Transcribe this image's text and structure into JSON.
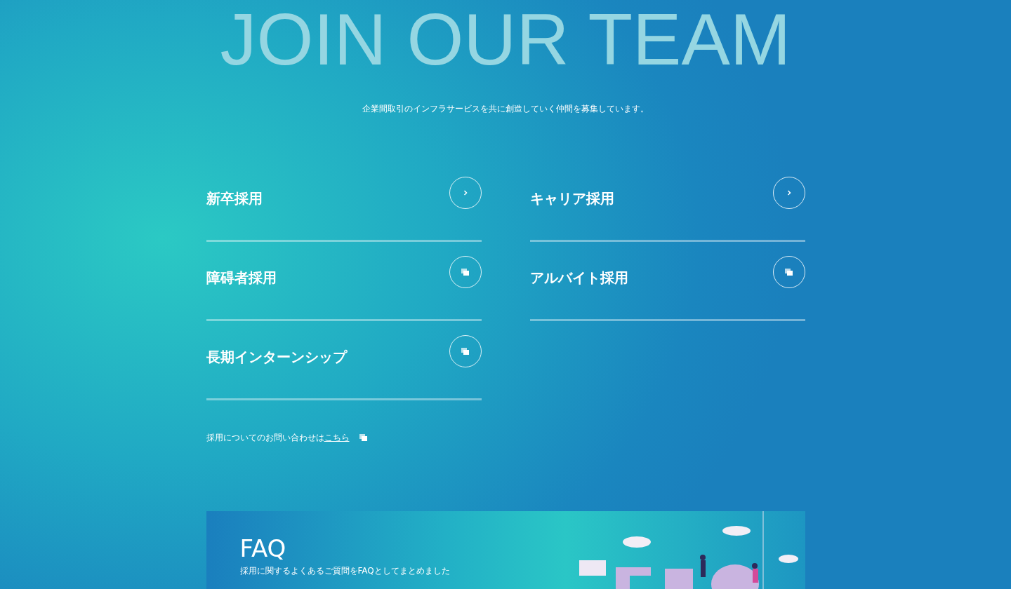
{
  "hero": {
    "title": "JOIN OUR TEAM",
    "lead": "企業間取引のインフラサービスを共に創造していく仲間を募集しています。"
  },
  "positions": [
    {
      "label": "新卒採用",
      "kind": "internal"
    },
    {
      "label": "キャリア採用",
      "kind": "internal"
    },
    {
      "label": "障碍者採用",
      "kind": "external"
    },
    {
      "label": "アルバイト採用",
      "kind": "external"
    },
    {
      "label": "長期インターンシップ",
      "kind": "external"
    }
  ],
  "contact": {
    "text": "採用についてのお問い合わせは",
    "link": "こちら"
  },
  "faq": {
    "title": "FAQ",
    "subtitle": "採用に関するよくあるご質問をFAQとしてまとめました"
  }
}
